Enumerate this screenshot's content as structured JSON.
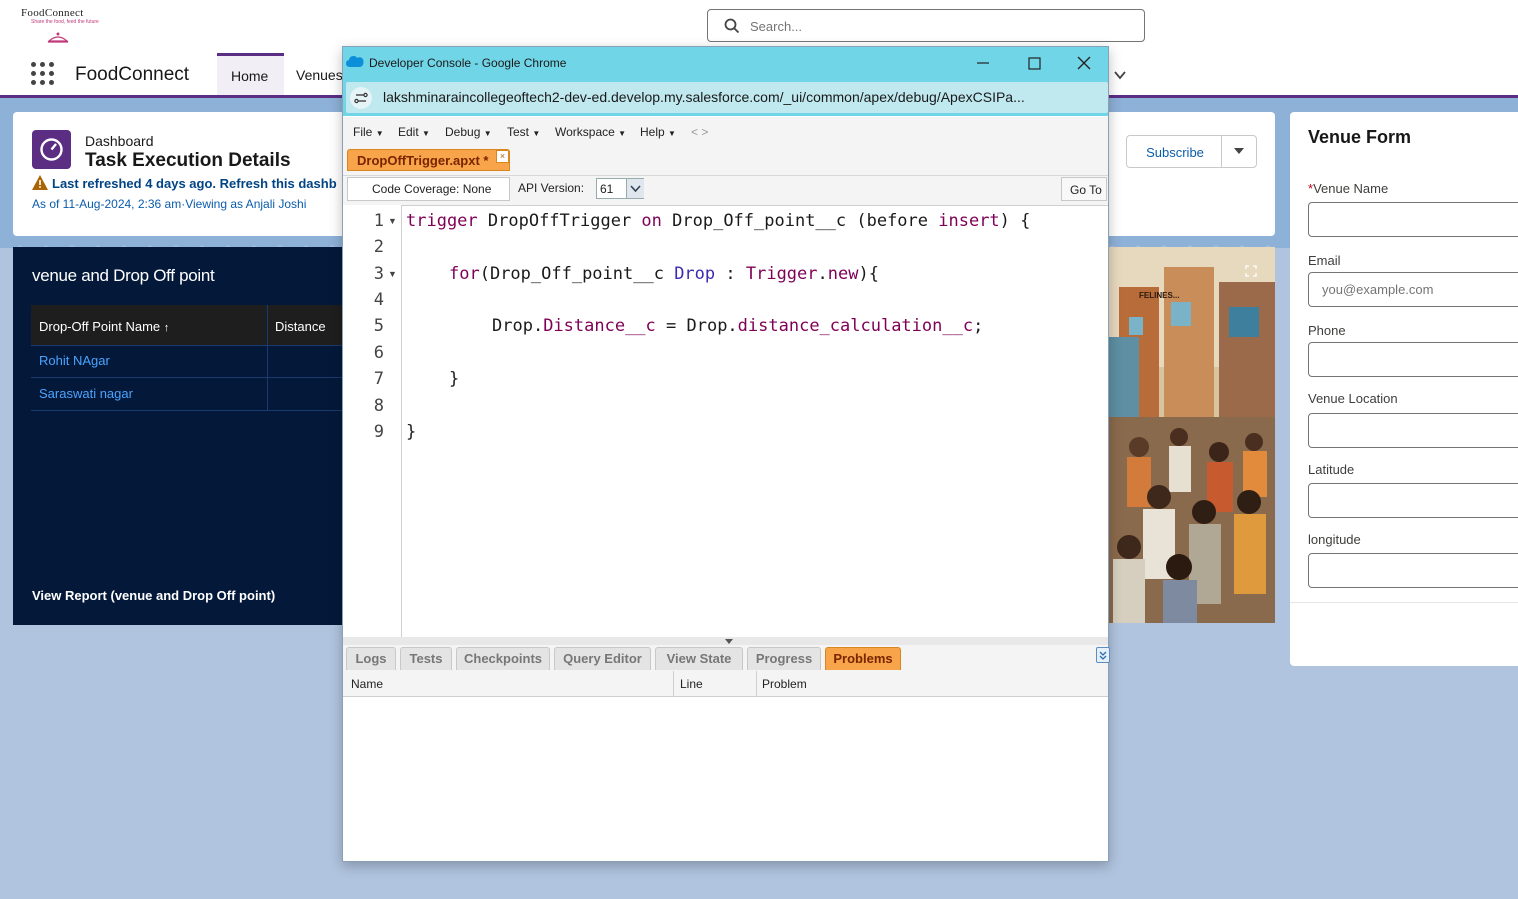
{
  "header": {
    "logo_title": "FoodConnect",
    "logo_tagline": "Share the food, feed the future",
    "search_placeholder": "Search...",
    "app_name": "FoodConnect",
    "tabs": [
      "Home",
      "Venues"
    ]
  },
  "dashboard": {
    "label": "Dashboard",
    "title": "Task Execution Details",
    "warning": "Last refreshed 4 days ago. Refresh this dashb",
    "as_of": "As of 11-Aug-2024, 2:36 am·Viewing as Anjali Joshi",
    "subscribe": "Subscribe"
  },
  "report": {
    "title": "venue and Drop Off point",
    "columns": [
      "Drop-Off Point Name",
      "Distance"
    ],
    "rows": [
      "Rohit NAgar",
      "Saraswati nagar"
    ],
    "view_link": "View Report (venue and Drop Off point)"
  },
  "picture": {
    "sign_text": "FELINES..."
  },
  "venue_form": {
    "title": "Venue Form",
    "required_mark": "*",
    "fields": [
      {
        "label": "Venue Name",
        "placeholder": ""
      },
      {
        "label": "Email",
        "placeholder": "you@example.com"
      },
      {
        "label": "Phone",
        "placeholder": ""
      },
      {
        "label": "Venue Location",
        "placeholder": ""
      },
      {
        "label": "Latitude",
        "placeholder": ""
      },
      {
        "label": "longitude",
        "placeholder": ""
      }
    ]
  },
  "console": {
    "window_title": "Developer Console - Google Chrome",
    "url": "lakshminaraincollegeoftech2-dev-ed.develop.my.salesforce.com/_ui/common/apex/debug/ApexCSIPa...",
    "menus": [
      "File",
      "Edit",
      "Debug",
      "Test",
      "Workspace",
      "Help"
    ],
    "nav_arrows": "<   >",
    "file_tab": "DropOffTrigger.apxt *",
    "code_coverage": "Code Coverage: None",
    "api_label": "API Version:",
    "api_value": "61",
    "goto": "Go To",
    "line_numbers": [
      "1",
      "2",
      "3",
      "4",
      "5",
      "6",
      "7",
      "8",
      "9"
    ],
    "code": {
      "l1_kw1": "trigger",
      "l1_name": " DropOffTrigger ",
      "l1_kw2": "on",
      "l1_obj": " Drop_Off_point__c (before ",
      "l1_kw3": "insert",
      "l1_end": ") {",
      "l3_kw": "for",
      "l3_open": "(Drop_Off_point__c ",
      "l3_var": "Drop",
      "l3_colon": " : ",
      "l3_trig": "Trigger",
      "l3_dot": ".",
      "l3_new": "new",
      "l3_end": "){",
      "l5_a": "Drop.",
      "l5_field1": "Distance__c",
      "l5_b": " = Drop.",
      "l5_field2": "distance_calculation__c",
      "l5_end": ";",
      "l7": "}",
      "l9": "}"
    },
    "bottom_tabs": [
      "Logs",
      "Tests",
      "Checkpoints",
      "Query Editor",
      "View State",
      "Progress",
      "Problems"
    ],
    "active_tab": "Problems",
    "grid_columns": [
      "Name",
      "Line",
      "Problem"
    ]
  },
  "colors": {
    "brand": "#5b2d83",
    "console_titlebar": "#70d5e6",
    "active_tab": "#f7a44a",
    "keyword": "#7f0055"
  }
}
